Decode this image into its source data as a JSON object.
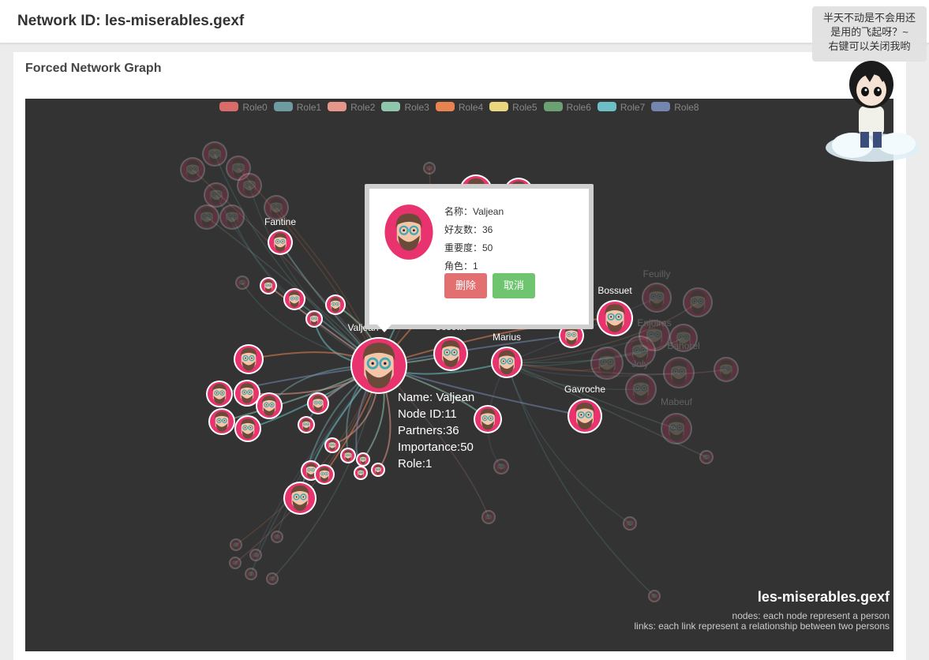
{
  "header": {
    "title": "Network ID: les-miserables.gexf"
  },
  "card": {
    "title": "Forced Network Graph"
  },
  "legend": [
    {
      "label": "Role0",
      "color": "#d96b6b"
    },
    {
      "label": "Role1",
      "color": "#6e9aa1"
    },
    {
      "label": "Role2",
      "color": "#e5988a"
    },
    {
      "label": "Role3",
      "color": "#8fc7ad"
    },
    {
      "label": "Role4",
      "color": "#e88250"
    },
    {
      "label": "Role5",
      "color": "#e9d67f"
    },
    {
      "label": "Role6",
      "color": "#6ba172"
    },
    {
      "label": "Role7",
      "color": "#6cbfc4"
    },
    {
      "label": "Role8",
      "color": "#7486b0"
    }
  ],
  "node_labels": {
    "fantine": "Fantine",
    "valjean": "Valjean",
    "cosette": "Cosette",
    "marius": "Marius",
    "bossuet": "Bossuet",
    "gavroche": "Gavroche",
    "feuilly": "Feuilly",
    "enjolras": "Enjolras",
    "bahorel": "Bahorel",
    "joly": "Joly",
    "mabeuf": "Mabeuf"
  },
  "selected_info": [
    "Name: Valjean",
    "Node ID:11",
    "Partners:36",
    "Importance:50",
    "Role:1"
  ],
  "popup": {
    "name_line": "名称：Valjean",
    "friends_line": "好友数：36",
    "importance_line": "重要度：50",
    "role_line": "角色：1",
    "delete_label": "删除",
    "cancel_label": "取消"
  },
  "caption": {
    "title": "les-miserables.gexf",
    "nodes_line": "nodes: each node represent a person",
    "links_line": "links: each link represent a relationship between two persons"
  },
  "mascot_bubble": {
    "line1": "半天不动是不会用还",
    "line2": "是用的飞起呀？~",
    "line3": "右键可以关闭我哟"
  },
  "colors": {
    "background": "#333333",
    "node_ring": "#ffffff",
    "node_face": "#e8336f",
    "delete_button": "#e27070",
    "cancel_button": "#6fc46f"
  }
}
